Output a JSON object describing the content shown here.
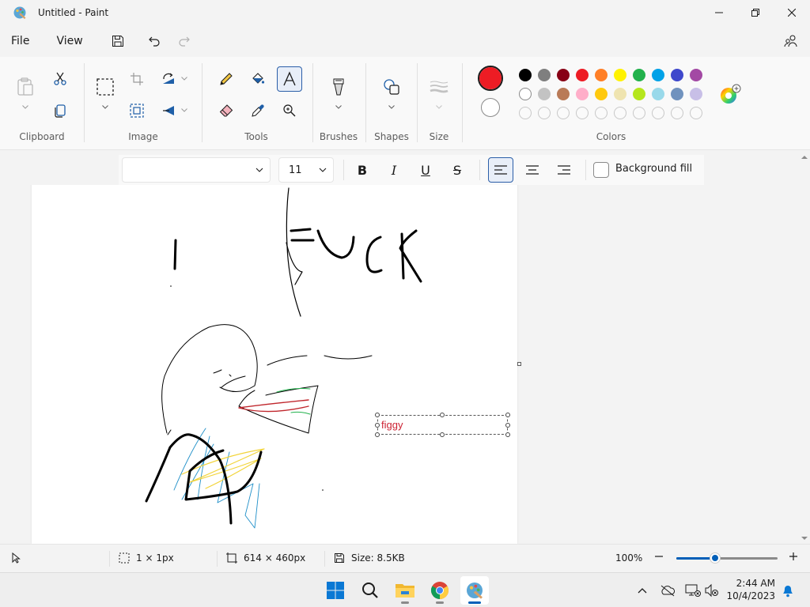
{
  "window": {
    "title": "Untitled - Paint",
    "controls": [
      "minimize",
      "maximize",
      "close"
    ]
  },
  "menu": {
    "file": "File",
    "view": "View"
  },
  "ribbon": {
    "groups": {
      "clipboard": "Clipboard",
      "image": "Image",
      "tools": "Tools",
      "brushes": "Brushes",
      "shapes": "Shapes",
      "size": "Size",
      "colors": "Colors"
    },
    "active_tool": "text-tool",
    "primary_color": "#ed1c24",
    "secondary_color": "#ffffff",
    "palette_row1": [
      "#000000",
      "#7f7f7f",
      "#880015",
      "#ed1c24",
      "#ff7f27",
      "#fff200",
      "#22b14c",
      "#00a2e8",
      "#3f48cc",
      "#a349a4"
    ],
    "palette_row2": [
      "#ffffff",
      "#c3c3c3",
      "#b97a57",
      "#ffaec9",
      "#ffc90e",
      "#efe4b0",
      "#b5e61d",
      "#99d9ea",
      "#7092be",
      "#c8bfe7"
    ],
    "palette_row3_count": 10
  },
  "text_toolbar": {
    "font_family": "",
    "font_size": "11",
    "bold": "B",
    "italic": "I",
    "underline": "U",
    "strikethrough": "S",
    "align_active": "left",
    "background_fill_label": "Background fill",
    "background_fill_checked": false
  },
  "canvas": {
    "textbox_text": "figgy"
  },
  "status": {
    "selection_size": "1 × 1px",
    "canvas_size": "614 × 460px",
    "file_size": "Size: 8.5KB",
    "zoom": "100%",
    "zoom_level": 0.38
  },
  "taskbar": {
    "time": "2:44 AM",
    "date": "10/4/2023",
    "apps": [
      "start",
      "search",
      "file-explorer",
      "chrome",
      "paint"
    ],
    "active_app": "paint"
  }
}
